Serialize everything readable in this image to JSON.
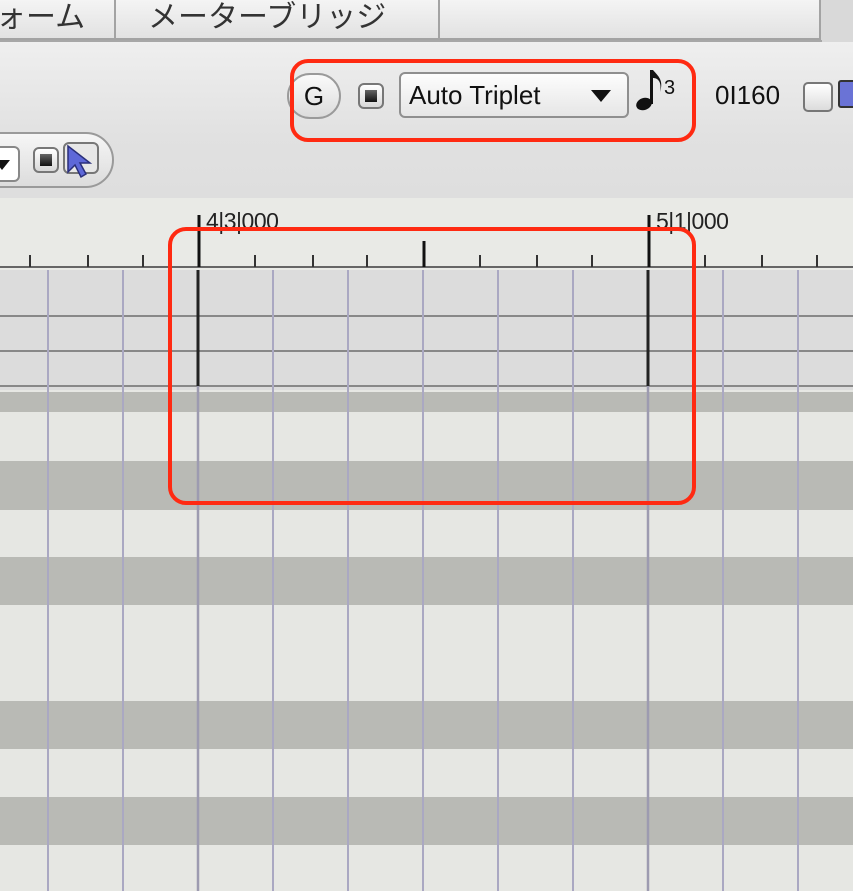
{
  "tabs": [
    {
      "label": "ォーム"
    },
    {
      "label": "メーターブリッジ"
    },
    {
      "label": ""
    }
  ],
  "toolbar": {
    "grid_button_label": "G",
    "triplet_select": {
      "value": "Auto Triplet"
    },
    "note_icon": "eighth-note-triplet-icon",
    "note_superscript": "3",
    "length_value": "0I160"
  },
  "ruler": {
    "bar_labels": [
      "4|3|000",
      "5|1|000"
    ]
  },
  "colors": {
    "highlight": "#ff2a12",
    "row_light": "#e6e7e3",
    "row_dark": "#b9bab5",
    "grid_line": "#aaa8c2",
    "beat_line": "#222222",
    "accent_blue": "#6a73d6"
  }
}
